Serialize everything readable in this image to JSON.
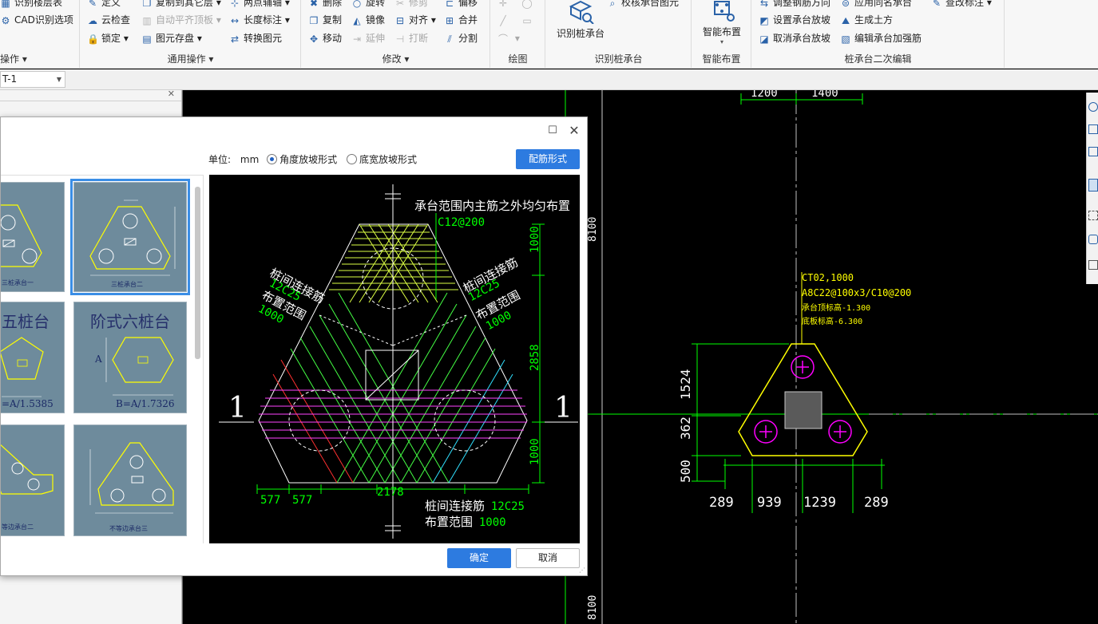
{
  "ribbon": {
    "group_partial": {
      "items": [
        "识别楼层表",
        "CAD识别选项"
      ],
      "label": "操作"
    },
    "group_common": {
      "label": "通用操作",
      "items": [
        "定义",
        "复制到其它层",
        "两点辅轴",
        "云检查",
        "自动平齐顶板",
        "长度标注",
        "锁定",
        "图元存盘",
        "转换图元"
      ]
    },
    "group_modify": {
      "label": "修改",
      "items": [
        "删除",
        "旋转",
        "修剪",
        "偏移",
        "复制",
        "镜像",
        "对齐",
        "合并",
        "移动",
        "延伸",
        "打断",
        "分割"
      ]
    },
    "group_draw": {
      "label": "绘图"
    },
    "group_identify": {
      "label": "识别桩承台",
      "big_button": "识别桩承台",
      "check_button": "校核承台图元"
    },
    "group_smart": {
      "label": "智能布置",
      "big_button": "智能布置"
    },
    "group_edit": {
      "label": "桩承台二次编辑",
      "items": [
        "调整钢筋方向",
        "应用同名承台",
        "查改标注",
        "设置承台放坡",
        "生成土方",
        "取消承台放坡",
        "编辑承台加强筋"
      ]
    }
  },
  "toolbar2": {
    "layer_value": "T-1"
  },
  "dialog": {
    "unit_label": "单位:",
    "unit_value": "mm",
    "radio_angle": "角度放坡形式",
    "radio_width": "底宽放坡形式",
    "rebar_button": "配筋形式",
    "ok_button": "确定",
    "cancel_button": "取消",
    "thumbs": [
      {
        "label": "三桩承台一"
      },
      {
        "label": "三桩承台二"
      },
      {
        "title": "五桩台",
        "formula": "=A/1.5385"
      },
      {
        "title": "阶式六桩台",
        "formula": "B=A/1.7326",
        "dim": "A"
      },
      {
        "label": "等边承台二"
      },
      {
        "label": "不等边承台三"
      }
    ],
    "preview": {
      "top_note": "承台范围内主筋之外均匀布置",
      "top_spec": "C12@200",
      "left_note": "桩间连接筋",
      "left_spec": "12C25",
      "left_range": "布置范围",
      "left_range_value": "1000",
      "right_note": "桩间连接筋",
      "right_spec": "12C25",
      "right_range": "布置范围",
      "right_range_value": "1000",
      "bottom_note": "桩间连接筋",
      "bottom_spec": "12C25",
      "bottom_range": "布置范围",
      "bottom_range_value": "1000",
      "section_mark": "1",
      "dim_v1": "1000",
      "dim_v2": "2858",
      "dim_v3": "1000",
      "dim_h1": "577",
      "dim_h2": "577",
      "dim_h3": "2178"
    }
  },
  "cad": {
    "top_dim_1": "1200",
    "top_dim_2": "1400",
    "axis_label_top": "8100",
    "axis_label_bottom": "8100",
    "cap_name": "CT02,1000",
    "cap_rebar": "A8C22@100x3/C10@200",
    "cap_top_elev": "承台顶标高-1.300",
    "cap_bottom_elev": "底板标高-6.300",
    "dim_v_1524": "1524",
    "dim_v_362": "362",
    "dim_v_500": "500",
    "dim_h_289a": "289",
    "dim_h_939": "939",
    "dim_h_1239": "1239",
    "dim_h_289b": "289"
  },
  "colors": {
    "accent_blue": "#2d7be0",
    "cad_green": "#00ff00",
    "cad_yellow": "#ffff00",
    "cad_magenta": "#ff00ff",
    "cad_cyan": "#00ffff",
    "cad_red": "#ff2020"
  }
}
